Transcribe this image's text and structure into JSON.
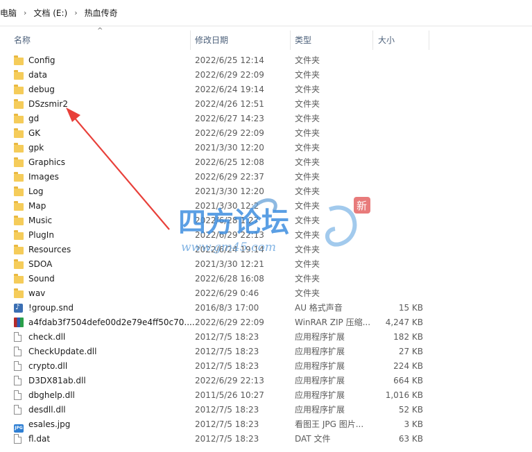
{
  "breadcrumb": {
    "items": [
      "电脑",
      "文档 (E:)",
      "热血传奇"
    ]
  },
  "columns": {
    "name": "名称",
    "date": "修改日期",
    "type": "类型",
    "size": "大小"
  },
  "files": [
    {
      "icon": "folder",
      "name": "Config",
      "date": "2022/6/25 12:14",
      "type": "文件夹",
      "size": ""
    },
    {
      "icon": "folder",
      "name": "data",
      "date": "2022/6/29 22:09",
      "type": "文件夹",
      "size": ""
    },
    {
      "icon": "folder",
      "name": "debug",
      "date": "2022/6/24 19:14",
      "type": "文件夹",
      "size": ""
    },
    {
      "icon": "folder",
      "name": "DSzsmir2",
      "date": "2022/4/26 12:51",
      "type": "文件夹",
      "size": ""
    },
    {
      "icon": "folder",
      "name": "gd",
      "date": "2022/6/27 14:23",
      "type": "文件夹",
      "size": ""
    },
    {
      "icon": "folder",
      "name": "GK",
      "date": "2022/6/29 22:09",
      "type": "文件夹",
      "size": ""
    },
    {
      "icon": "folder",
      "name": "gpk",
      "date": "2021/3/30 12:20",
      "type": "文件夹",
      "size": ""
    },
    {
      "icon": "folder",
      "name": "Graphics",
      "date": "2022/6/25 12:08",
      "type": "文件夹",
      "size": ""
    },
    {
      "icon": "folder",
      "name": "Images",
      "date": "2022/6/29 22:37",
      "type": "文件夹",
      "size": ""
    },
    {
      "icon": "folder",
      "name": "Log",
      "date": "2021/3/30 12:20",
      "type": "文件夹",
      "size": ""
    },
    {
      "icon": "folder",
      "name": "Map",
      "date": "2021/3/30 12:2",
      "type": "文件夹",
      "size": ""
    },
    {
      "icon": "folder",
      "name": "Music",
      "date": "2022/6/28 1:27",
      "type": "文件夹",
      "size": ""
    },
    {
      "icon": "folder",
      "name": "PlugIn",
      "date": "2022/6/29 22:13",
      "type": "文件夹",
      "size": ""
    },
    {
      "icon": "folder",
      "name": "Resources",
      "date": "2022/6/24 19:14",
      "type": "文件夹",
      "size": ""
    },
    {
      "icon": "folder",
      "name": "SDOA",
      "date": "2021/3/30 12:21",
      "type": "文件夹",
      "size": ""
    },
    {
      "icon": "folder",
      "name": "Sound",
      "date": "2022/6/28 16:08",
      "type": "文件夹",
      "size": ""
    },
    {
      "icon": "folder",
      "name": "wav",
      "date": "2022/6/29 0:46",
      "type": "文件夹",
      "size": ""
    },
    {
      "icon": "snd",
      "name": "!group.snd",
      "date": "2016/8/3 17:00",
      "type": "AU 格式声音",
      "size": "15 KB"
    },
    {
      "icon": "zip",
      "name": "a4fdab3f7504defe00d2e79e4ff50c70....",
      "date": "2022/6/29 22:09",
      "type": "WinRAR ZIP 压缩...",
      "size": "4,247 KB"
    },
    {
      "icon": "file",
      "name": "check.dll",
      "date": "2012/7/5 18:23",
      "type": "应用程序扩展",
      "size": "182 KB"
    },
    {
      "icon": "file",
      "name": "CheckUpdate.dll",
      "date": "2012/7/5 18:23",
      "type": "应用程序扩展",
      "size": "27 KB"
    },
    {
      "icon": "file",
      "name": "crypto.dll",
      "date": "2012/7/5 18:23",
      "type": "应用程序扩展",
      "size": "224 KB"
    },
    {
      "icon": "file",
      "name": "D3DX81ab.dll",
      "date": "2022/6/29 22:13",
      "type": "应用程序扩展",
      "size": "664 KB"
    },
    {
      "icon": "file",
      "name": "dbghelp.dll",
      "date": "2011/5/26 10:27",
      "type": "应用程序扩展",
      "size": "1,016 KB"
    },
    {
      "icon": "file",
      "name": "desdll.dll",
      "date": "2012/7/5 18:23",
      "type": "应用程序扩展",
      "size": "52 KB"
    },
    {
      "icon": "jpg",
      "name": "esales.jpg",
      "date": "2012/7/5 18:23",
      "type": "看图王 JPG 图片...",
      "size": "3 KB"
    },
    {
      "icon": "file",
      "name": "fl.dat",
      "date": "2012/7/5 18:23",
      "type": "DAT 文件",
      "size": "63 KB"
    }
  ],
  "watermark": {
    "text": "四方论坛",
    "badge": "新",
    "url": "www.gm45.com"
  },
  "colors": {
    "annotation_arrow": "#e8403a",
    "folder": "#f5cc5a",
    "header_text": "#4c607a"
  }
}
